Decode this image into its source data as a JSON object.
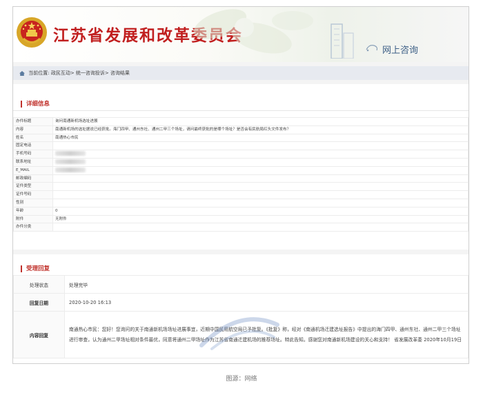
{
  "header": {
    "site_title": "江苏省发展和改革委员会",
    "section_name": "网上咨询"
  },
  "breadcrumb": {
    "prefix": "当前位置:",
    "items": [
      "政民互动",
      "统一咨询投诉",
      "咨询结果"
    ],
    "separator": "> "
  },
  "detail": {
    "section_title": "详细信息",
    "rows": [
      {
        "label": "办件标题",
        "value": "询问南通新机场选址进展"
      },
      {
        "label": "内容",
        "value": "南通新机场的选址据说已经获批。海门四甲、通州东社、通州二甲三个场址，请问最终获批的是哪个场址？是否会有民航局红头文件发布？"
      },
      {
        "label": "姓名",
        "value": "南通热心市民"
      },
      {
        "label": "固定电话",
        "value": ""
      },
      {
        "label": "手机号码",
        "value": "",
        "redacted": true
      },
      {
        "label": "联系地址",
        "value": "",
        "redacted": true
      },
      {
        "label": "E_MAIL",
        "value": "",
        "redacted": true
      },
      {
        "label": "邮政编码",
        "value": ""
      },
      {
        "label": "证件类型",
        "value": ""
      },
      {
        "label": "证件号码",
        "value": ""
      },
      {
        "label": "性别",
        "value": ""
      },
      {
        "label": "年龄",
        "value": "0"
      },
      {
        "label": "附件",
        "value": "无附件"
      },
      {
        "label": "办件分类",
        "value": ""
      }
    ]
  },
  "reply": {
    "section_title": "受理回复",
    "status_label": "处理状态",
    "status_value": "处理完毕",
    "date_label": "回复日期",
    "date_value": "2020-10-20 16:13",
    "content_label": "内容回复",
    "content_value": "南通热心市民：您好！您询问的关于南通新机场场址进展事宜，近期中国民用航空局已予批复。《批复》称，经对《南通机场迁建选址报告》中提出的海门四甲、通州东社、通州二甲三个场址进行审查，认为通州二甲场址相对条件最优，同意将通州二甲场址作为江苏省南通迁建机场的推荐场址。特此告知。感谢您对南通新机场建设的关心和支持！ 省发展改革委 2020年10月19日"
  },
  "caption": "图源：网络",
  "colors": {
    "brand_red": "#c11f1f",
    "section_red": "#c0312b",
    "nav_blue": "#3d5f86"
  },
  "icons": {
    "emblem": "national-emblem-icon",
    "home": "home-icon",
    "section": "chat-icon",
    "building": "building-icon"
  }
}
